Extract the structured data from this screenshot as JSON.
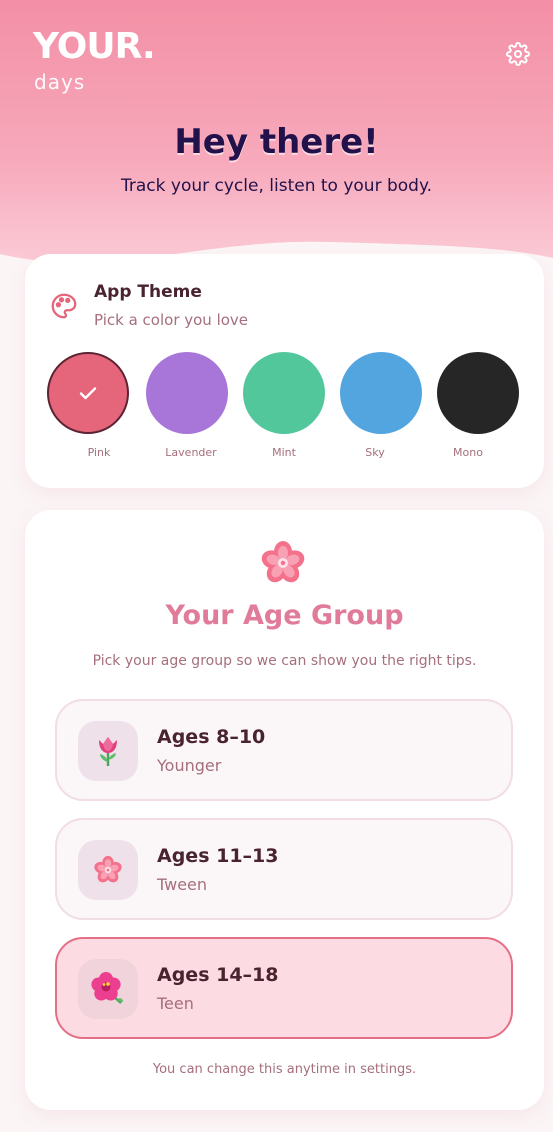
{
  "app": {
    "logo_main": "YOUR.",
    "logo_sub": "days"
  },
  "header": {
    "title": "Hey there!",
    "subtitle": "Track your cycle, listen to your body.",
    "settings_icon": "gear-icon"
  },
  "theme": {
    "title": "App Theme",
    "subtitle": "Pick a color you love",
    "icon": "palette-icon",
    "selected": "Pink",
    "swatches": [
      {
        "label": "Pink",
        "color": "#e5657a"
      },
      {
        "label": "Lavender",
        "color": "#a876d8"
      },
      {
        "label": "Mint",
        "color": "#52c79c"
      },
      {
        "label": "Sky",
        "color": "#53a5e0"
      },
      {
        "label": "Mono",
        "color": "#262626"
      }
    ]
  },
  "age_group": {
    "title": "Your Age Group",
    "subtitle": "Pick your age group so we can show you the right tips.",
    "icon": "cherry-blossom-icon",
    "selected": "Ages 14–18",
    "options": [
      {
        "title": "Ages 8–10",
        "subtitle": "Younger",
        "icon": "tulip-icon"
      },
      {
        "title": "Ages 11–13",
        "subtitle": "Tween",
        "icon": "cherry-blossom-icon"
      },
      {
        "title": "Ages 14–18",
        "subtitle": "Teen",
        "icon": "hibiscus-icon"
      }
    ],
    "footnote": "You can change this anytime in settings."
  },
  "colors": {
    "accent": "#e56f86",
    "header_top": "#f38fa6",
    "title_dark": "#22114a",
    "age_title": "#e07b9a"
  }
}
